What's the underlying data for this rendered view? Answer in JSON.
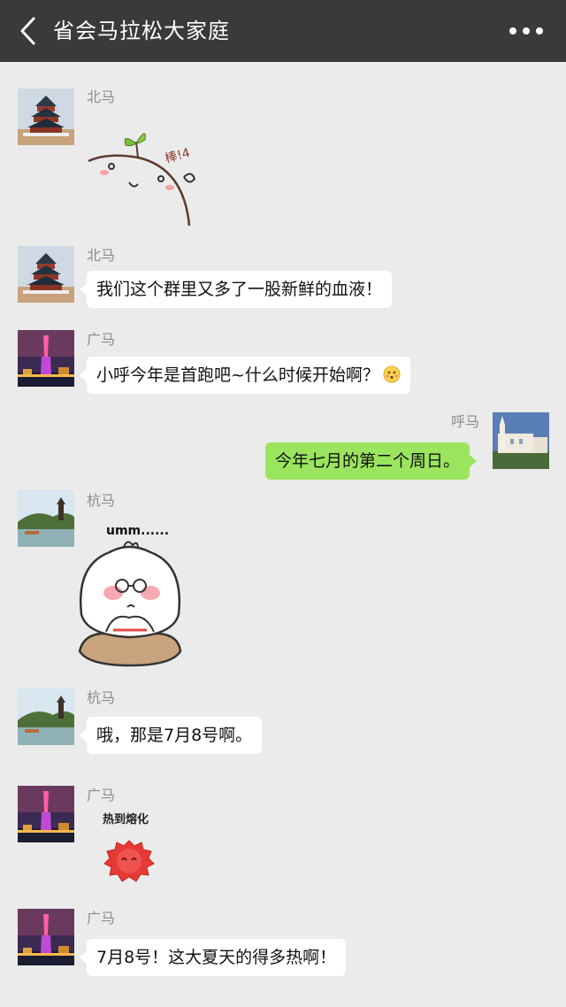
{
  "header": {
    "title": "省会马拉松大家庭",
    "back_icon": "chevron-left-icon",
    "more_icon": "more-dots-icon",
    "background": "#3a3a3a"
  },
  "colors": {
    "chat_bg": "#ebebeb",
    "bubble_in": "#ffffff",
    "bubble_out": "#9be55e",
    "name_text": "#8c8c8c"
  },
  "messages": [
    {
      "sender": "北马",
      "type": "sticker",
      "sticker_text": "棒!4"
    },
    {
      "sender": "北马",
      "type": "text",
      "text": "我们这个群里又多了一股新鲜的血液！"
    },
    {
      "sender": "广马",
      "type": "text",
      "text": "小呼今年是首跑吧~什么时候开始啊？",
      "emoji": "blush-emoji-icon"
    },
    {
      "sender": "呼马",
      "type": "text",
      "outgoing": true,
      "text": "今年七月的第二个周日。"
    },
    {
      "sender": "杭马",
      "type": "sticker",
      "sticker_text": "umm......"
    },
    {
      "sender": "杭马",
      "type": "text",
      "text": "哦，那是7月8号啊。"
    },
    {
      "sender": "广马",
      "type": "sticker",
      "sticker_text": "热到熔化"
    },
    {
      "sender": "广马",
      "type": "text",
      "text": "7月8号！这大夏天的得多热啊！"
    }
  ]
}
